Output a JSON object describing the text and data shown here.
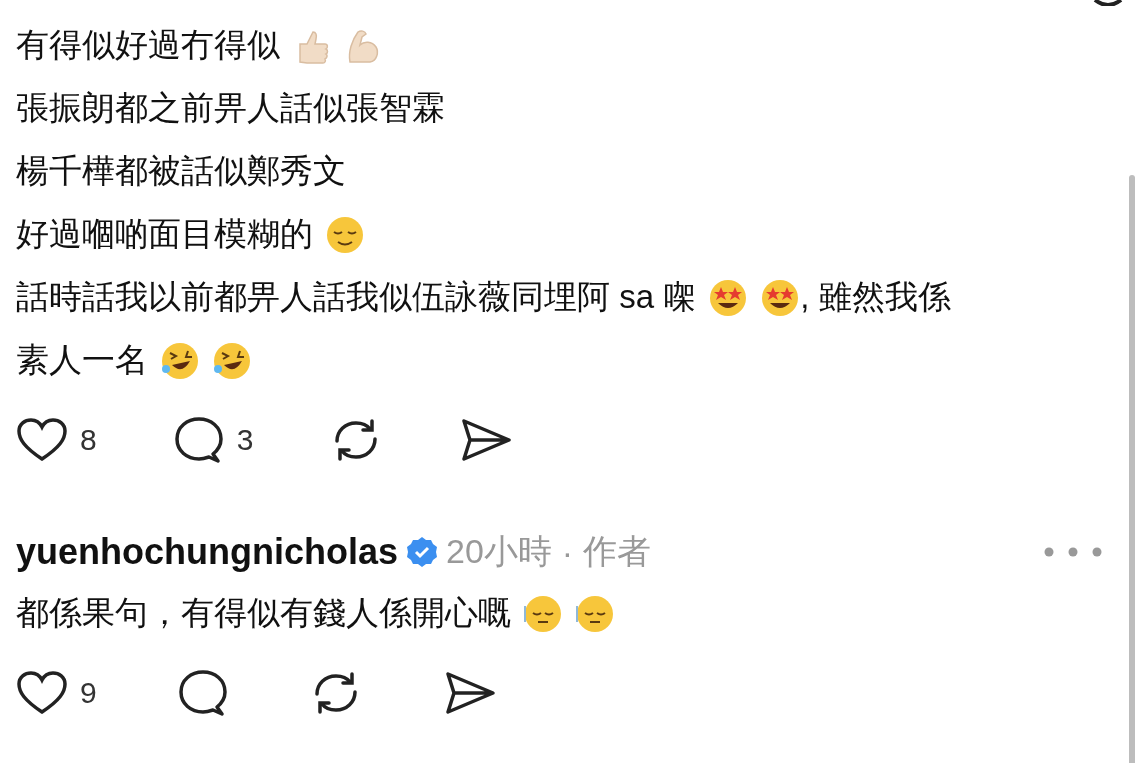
{
  "post": {
    "lines": [
      [
        {
          "kind": "text",
          "text": "有得似好過冇得似"
        },
        {
          "kind": "thumbs"
        },
        {
          "kind": "muscle"
        }
      ],
      [
        {
          "kind": "text",
          "text": "張振朗都之前畀人話似張智霖"
        }
      ],
      [
        {
          "kind": "text",
          "text": "楊千樺都被話似鄭秀文"
        }
      ],
      [
        {
          "kind": "text",
          "text": "好過嗰啲面目模糊的"
        },
        {
          "kind": "relieved"
        }
      ],
      [
        {
          "kind": "text",
          "text": "話時話我以前都畀人話我似伍詠薇同埋阿 sa 㗎"
        },
        {
          "kind": "starstruck"
        },
        {
          "kind": "starstruck"
        },
        {
          "kind": "text",
          "text": ", 雖然我係"
        }
      ],
      [
        {
          "kind": "text",
          "text": "素人一名"
        },
        {
          "kind": "rofl"
        },
        {
          "kind": "rofl"
        }
      ]
    ],
    "actions": {
      "likes": "8",
      "replies": "3"
    }
  },
  "reply": {
    "username": "yuenhochungnicholas",
    "verified": true,
    "time": "20小時",
    "separator": "·",
    "tag": "作者",
    "lines": [
      [
        {
          "kind": "text",
          "text": "都係果句，有得似有錢人係開心嘅"
        },
        {
          "kind": "pensive"
        },
        {
          "kind": "pensive"
        }
      ]
    ],
    "actions": {
      "likes": "9"
    }
  }
}
